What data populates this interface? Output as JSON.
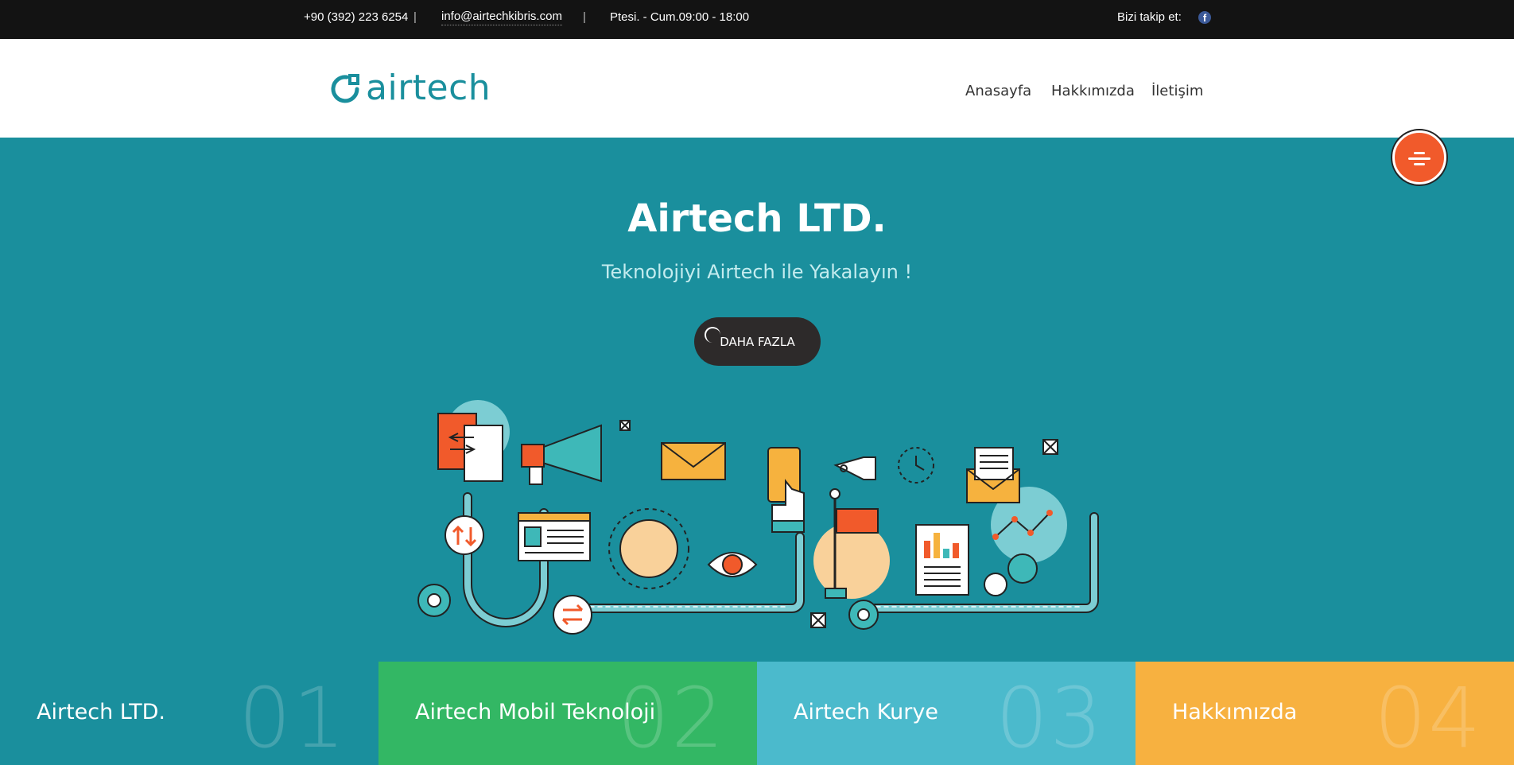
{
  "topbar": {
    "phone": "+90 (392) 223 6254",
    "separator": "|",
    "email": "info@airtechkibris.com",
    "hours": "Ptesi. - Cum.09:00 - 18:00",
    "follow_label": "Bizi takip et:",
    "social_icon": "facebook-icon"
  },
  "header": {
    "logo_text": "airtech",
    "nav": {
      "home": "Anasayfa",
      "about": "Hakkımızda",
      "contact": "İletişim"
    }
  },
  "hero": {
    "title": "Airtech LTD.",
    "subtitle": "Teknolojiyi Airtech ile Yakalayın !",
    "button_label": "DAHA FAZLA"
  },
  "tiles": [
    {
      "label": "Airtech LTD.",
      "number": "01",
      "color": "#1a8f9d"
    },
    {
      "label": "Airtech Mobil Teknoloji",
      "number": "02",
      "color": "#33b764"
    },
    {
      "label": "Airtech Kurye",
      "number": "03",
      "color": "#4bbacc"
    },
    {
      "label": "Hakkımızda",
      "number": "04",
      "color": "#f7b140"
    }
  ],
  "colors": {
    "brand_teal": "#1a8f9d",
    "accent_orange": "#f15a2b",
    "topbar_bg": "#131313"
  }
}
